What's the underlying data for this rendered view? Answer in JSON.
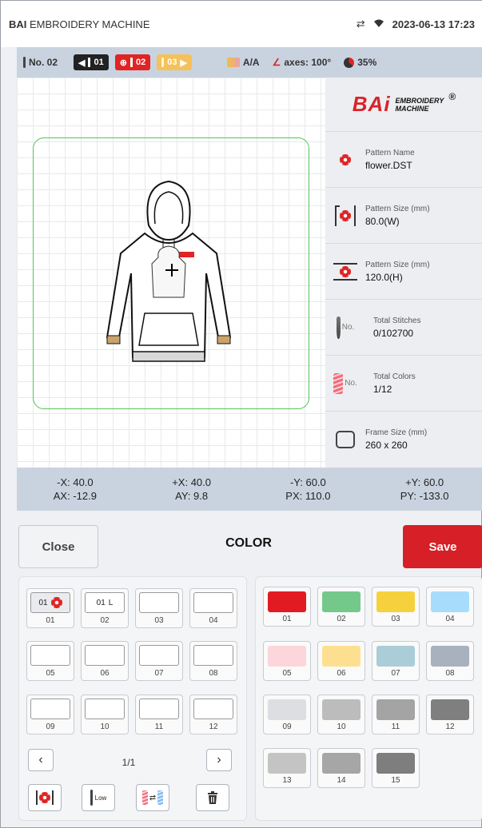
{
  "status_bar": {
    "brand_bold": "BAI",
    "brand_rest": " EMBROIDERY MACHINE",
    "datetime": "2023-06-13 17:23",
    "icons": [
      "usb-icon",
      "wifi-icon"
    ]
  },
  "toolbar": {
    "needle_no": "No. 02",
    "prev_needle": "01",
    "current_needle": "02",
    "next_needle": "03",
    "mode": "A/A",
    "axes": "axes: 100°",
    "progress": "35%",
    "progress_fraction": 0.35,
    "colors": {
      "dark": "#222222",
      "red": "#e02424",
      "yellow": "#f5c15a"
    }
  },
  "logo": {
    "name": "BAi",
    "line1": "EMBROIDERY",
    "line2": "MACHINE",
    "reg": "®"
  },
  "info": [
    {
      "label": "Pattern Name",
      "value": "flower.DST",
      "icon": "flower-icon"
    },
    {
      "label": "Pattern Size (mm)",
      "value": "80.0(W)",
      "icon": "width-icon"
    },
    {
      "label": "Pattern Size (mm)",
      "value": "120.0(H)",
      "icon": "height-icon"
    },
    {
      "label": "Total Stitches",
      "value": "0/102700",
      "icon": "needle-icon",
      "suffix": "No."
    },
    {
      "label": "Total Colors",
      "value": "1/12",
      "icon": "thread-icon",
      "suffix": "No."
    },
    {
      "label": "Frame Size (mm)",
      "value": "260 x 260",
      "icon": "frame-icon"
    }
  ],
  "coords": {
    "neg_x": "-X: 40.0",
    "pos_x": "+X: 40.0",
    "neg_y": "-Y: 60.0",
    "pos_y": "+Y: 60.0",
    "ax": "AX: -12.9",
    "ay": "AY: 9.8",
    "px": "PX: 110.0",
    "py": "PY: -133.0"
  },
  "actions": {
    "close": "Close",
    "title": "COLOR",
    "save": "Save"
  },
  "needles": [
    {
      "num": "01",
      "tag": "01",
      "mark": "flower"
    },
    {
      "num": "02",
      "tag": "01",
      "mark": "L"
    },
    {
      "num": "03"
    },
    {
      "num": "04"
    },
    {
      "num": "05"
    },
    {
      "num": "06"
    },
    {
      "num": "07"
    },
    {
      "num": "08"
    },
    {
      "num": "09"
    },
    {
      "num": "10"
    },
    {
      "num": "11"
    },
    {
      "num": "12"
    }
  ],
  "pager": {
    "text": "1/1"
  },
  "tools": {
    "low": "Low"
  },
  "colors": [
    {
      "num": "01",
      "hex": "#e21b22"
    },
    {
      "num": "02",
      "hex": "#74c98a"
    },
    {
      "num": "03",
      "hex": "#f6d13e"
    },
    {
      "num": "04",
      "hex": "#a7ddfb"
    },
    {
      "num": "05",
      "hex": "#fcd6da"
    },
    {
      "num": "06",
      "hex": "#fde08f"
    },
    {
      "num": "07",
      "hex": "#aacdd8"
    },
    {
      "num": "08",
      "hex": "#a9b1bf"
    },
    {
      "num": "09",
      "hex": "#dcdee1"
    },
    {
      "num": "10",
      "hex": "#bcbcbc"
    },
    {
      "num": "11",
      "hex": "#a4a4a4"
    },
    {
      "num": "12",
      "hex": "#7f7f7f"
    },
    {
      "num": "13",
      "hex": "#c4c4c4"
    },
    {
      "num": "14",
      "hex": "#a6a6a6"
    },
    {
      "num": "15",
      "hex": "#7e7e7e"
    }
  ]
}
